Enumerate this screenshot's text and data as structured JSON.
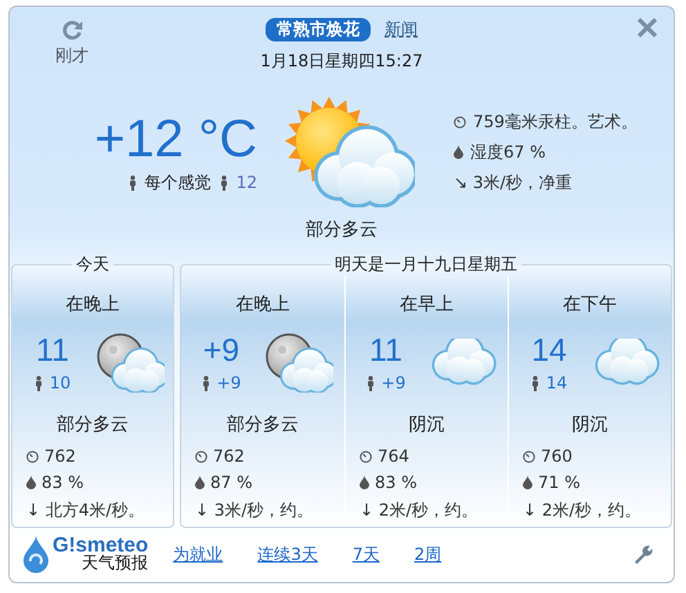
{
  "header": {
    "refresh_label": "刚才",
    "location": "常熟市焕花",
    "news_link": "新闻",
    "date_time": "1月18日星期四15:27"
  },
  "current": {
    "temperature": "+12 °C",
    "feels_like_label": "每个感觉",
    "feels_like": "12",
    "kind": "sun-cloud",
    "condition": "部分多云",
    "pressure": "759毫米汞柱。艺术。",
    "humidity": "湿度67 %",
    "wind": "↘ 3米/秒，净重"
  },
  "forecast": [
    {
      "label": "今天",
      "periods": [
        {
          "name": "在晚上",
          "kind": "moon-cloud",
          "temperature": "11",
          "feels_like": "10",
          "condition": "部分多云",
          "pressure": "762",
          "humidity": "83 %",
          "wind": "↓ 北方4米/秒。"
        }
      ]
    },
    {
      "label": "明天是一月十九日星期五",
      "periods": [
        {
          "name": "在晚上",
          "kind": "moon-cloud",
          "temperature": "+9",
          "feels_like": "+9",
          "condition": "部分多云",
          "pressure": "762",
          "humidity": "87 %",
          "wind": "↓ 3米/秒，约。"
        },
        {
          "name": "在早上",
          "kind": "cloud",
          "temperature": "11",
          "feels_like": "+9",
          "condition": "阴沉",
          "pressure": "764",
          "humidity": "83 %",
          "wind": "↓ 2米/秒，约。"
        },
        {
          "name": "在下午",
          "kind": "cloud",
          "temperature": "14",
          "feels_like": "14",
          "condition": "阴沉",
          "pressure": "760",
          "humidity": "71 %",
          "wind": "↓ 2米/秒，约。"
        }
      ]
    }
  ],
  "footer": {
    "logo": "G!smeteo",
    "logo_subtitle": "天气预报",
    "links": [
      "为就业",
      "连续3天",
      "7天",
      "2周"
    ]
  }
}
